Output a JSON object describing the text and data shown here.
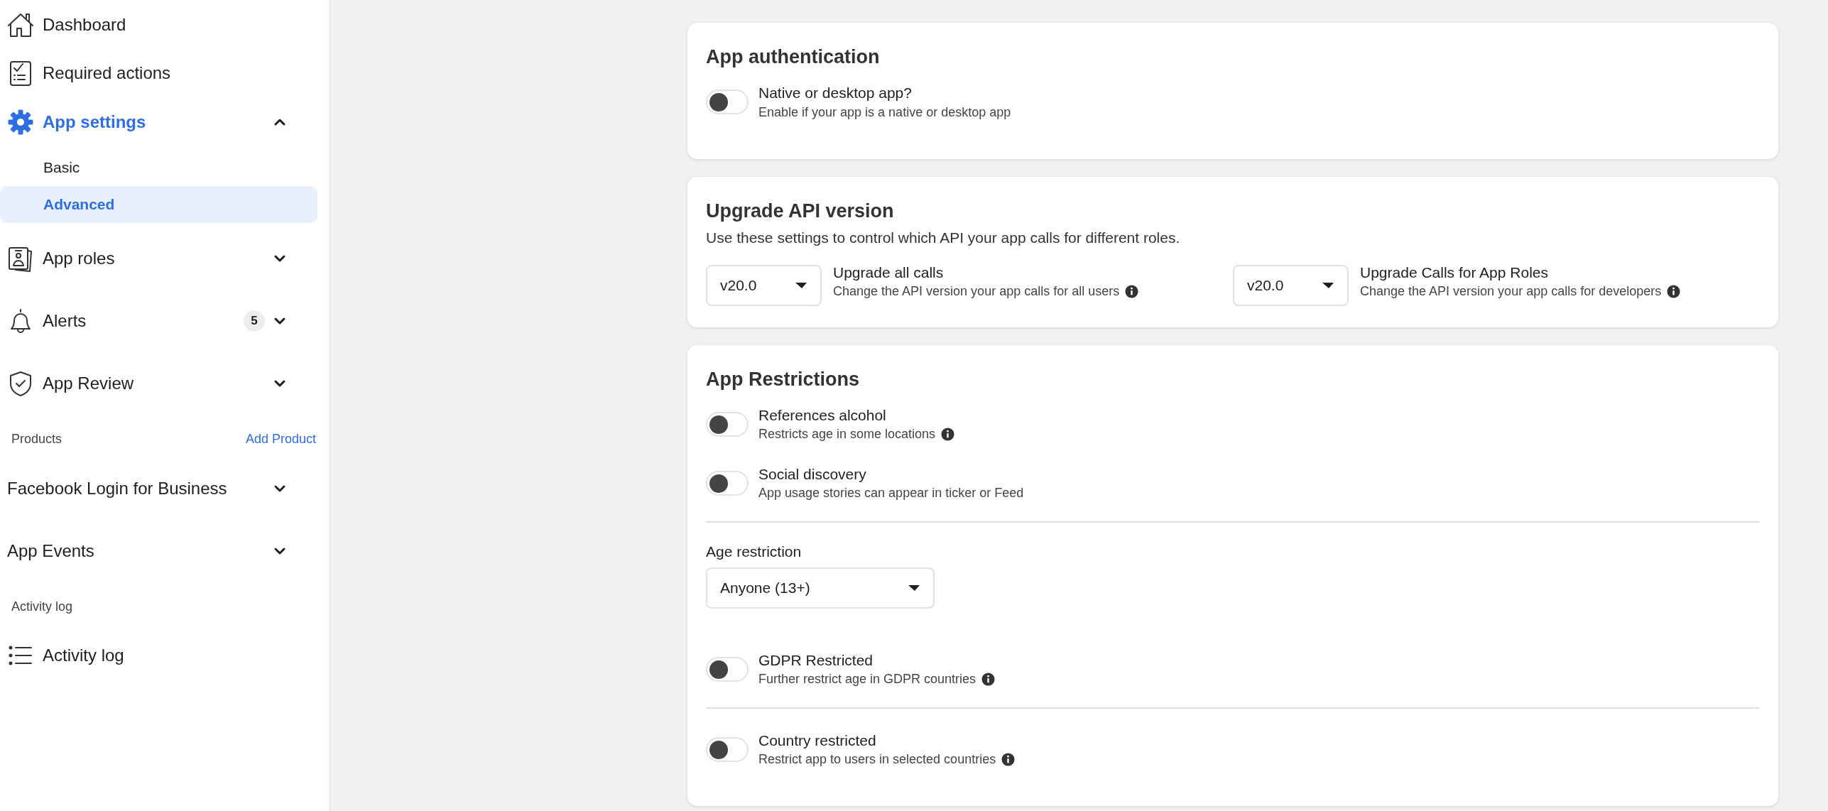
{
  "sidebar": {
    "items": [
      {
        "kind": "link",
        "label": "Dashboard",
        "selected": false
      },
      {
        "kind": "link",
        "label": "Required actions",
        "selected": false
      },
      {
        "kind": "group",
        "label": "App settings",
        "selected": true,
        "expanded": true,
        "children": [
          {
            "label": "Basic",
            "selected": false
          },
          {
            "label": "Advanced",
            "selected": true
          }
        ]
      },
      {
        "kind": "group",
        "label": "App roles",
        "selected": false,
        "expanded": false
      },
      {
        "kind": "group",
        "label": "Alerts",
        "badge": "5",
        "selected": false,
        "expanded": false
      },
      {
        "kind": "group",
        "label": "App Review",
        "selected": false,
        "expanded": false
      },
      {
        "kind": "section",
        "label": "Products",
        "action": "Add Product"
      },
      {
        "kind": "group",
        "label": "Facebook Login for Business",
        "selected": false,
        "expanded": false
      },
      {
        "kind": "group",
        "label": "App Events",
        "selected": false,
        "expanded": false
      },
      {
        "kind": "section",
        "label": "Activity log"
      },
      {
        "kind": "link",
        "label": "Activity log",
        "selected": false
      }
    ]
  },
  "cards": [
    {
      "title": "App authentication",
      "items": [
        {
          "kind": "toggle",
          "label": "Native or desktop app?",
          "description": "Enable if your app is a native or desktop app",
          "on": false,
          "info": false
        }
      ]
    },
    {
      "title": "Upgrade API version",
      "items": [
        {
          "kind": "text",
          "text": "Use these settings to control which API your app calls for different roles."
        },
        {
          "kind": "version-selects",
          "selects": [
            {
              "value": "v20.0",
              "label": "Upgrade all calls",
              "description": "Change the API version your app calls for all users",
              "info": true
            },
            {
              "value": "v20.0",
              "label": "Upgrade Calls for App Roles",
              "description": "Change the API version your app calls for developers",
              "info": true
            }
          ]
        }
      ]
    },
    {
      "title": "App Restrictions",
      "items": [
        {
          "kind": "toggle",
          "label": "References alcohol",
          "description": "Restricts age in some locations",
          "on": false,
          "info": true
        },
        {
          "kind": "toggle",
          "label": "Social discovery",
          "description": "App usage stories can appear in ticker or Feed",
          "on": false,
          "info": false
        },
        {
          "kind": "divider"
        },
        {
          "kind": "select",
          "label": "Age restriction",
          "value": "Anyone (13+)"
        },
        {
          "kind": "toggle",
          "label": "GDPR Restricted",
          "description": "Further restrict age in GDPR countries",
          "on": false,
          "info": true
        },
        {
          "kind": "divider"
        },
        {
          "kind": "toggle",
          "label": "Country restricted",
          "description": "Restrict app to users in selected countries",
          "on": false,
          "info": true
        }
      ]
    }
  ]
}
